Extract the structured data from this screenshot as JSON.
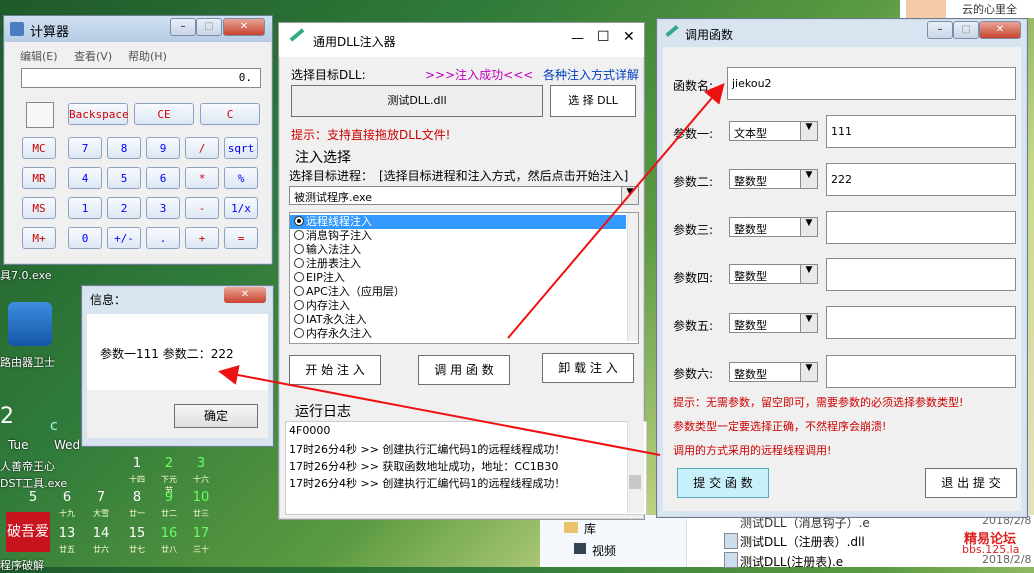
{
  "desktop": {
    "labels": {
      "tool70": "具7.0.exe",
      "router": "路由器卫士",
      "king": "人善帝王心",
      "dst": "DST工具.exe",
      "hack": "程序破解",
      "topright": "云的心里全",
      "folder": "库",
      "video": "视频",
      "file1": "测试DLL（注册表）.dll",
      "file2": "测试DLL(注册表).e",
      "file0": "测试DLL（消息钩子）.e",
      "date1": "2018/2/8",
      "date2": "2018/2/8",
      "watermark1": "精易论坛",
      "watermark2": "bbs.125.la",
      "stamp": "破吾爱"
    },
    "calendar": {
      "time_digit": "2",
      "day_c": "c",
      "weekdays": [
        "Tue",
        "Wed"
      ],
      "rows": [
        {
          "nums": [
            "1",
            "2",
            "3"
          ],
          "subs": [
            "十四",
            "下元节",
            "十六"
          ]
        },
        {
          "nums": [
            "5",
            "6",
            "7",
            "8",
            "9",
            "10"
          ],
          "subs": [
            "",
            "十九",
            "大雪",
            "廿一",
            "廿二",
            "廿三"
          ]
        },
        {
          "nums": [
            "12",
            "13",
            "14",
            "15",
            "16",
            "17"
          ],
          "subs": [
            "",
            "廿五",
            "廿六",
            "廿七",
            "廿八",
            "三十"
          ]
        }
      ]
    }
  },
  "calc": {
    "title": "计算器",
    "menu": [
      "编辑(E)",
      "查看(V)",
      "帮助(H)"
    ],
    "display": "0.",
    "top_buttons": [
      "Backspace",
      "CE",
      "C"
    ],
    "rows": [
      [
        "MC",
        "7",
        "8",
        "9",
        "/",
        "sqrt"
      ],
      [
        "MR",
        "4",
        "5",
        "6",
        "*",
        "%"
      ],
      [
        "MS",
        "1",
        "2",
        "3",
        "-",
        "1/x"
      ],
      [
        "M+",
        "0",
        "+/-",
        ".",
        "+",
        "="
      ]
    ]
  },
  "msgbox": {
    "title": "信息：",
    "close": "✕",
    "message": "参数一111 参数二：222",
    "ok": "确定"
  },
  "injector": {
    "title": "通用DLL注入器",
    "select_dll_label": "选择目标DLL:",
    "success": ">>>注入成功<<<",
    "methods_link": "各种注入方式详解",
    "dll_name": "测试DLL.dll",
    "select_dll_btn": "选 择 DLL",
    "hint": "提示：支持直接拖放DLL文件!",
    "group_title": "注入选择",
    "process_label": "选择目标进程：",
    "process_hint": "[选择目标进程和注入方式，然后点击开始注入]",
    "process_value": "被测试程序.exe",
    "methods": [
      "远程线程注入",
      "消息钩子注入",
      "输入法注入",
      "注册表注入",
      "EIP注入",
      "APC注入（应用层）",
      "内存注入",
      "IAT永久注入",
      "内存永久注入"
    ],
    "selected_method": "远程线程注入",
    "start_btn": "开 始 注 入",
    "call_btn": "调 用 函 数",
    "unload_btn": "卸 载 注 入",
    "log_title": "运行日志",
    "log": [
      "4F0000",
      "17时26分4秒 >> 创建执行汇编代码1的远程线程成功！",
      "17时26分4秒 >> 获取函数地址成功，地址：CC1B30",
      "17时26分4秒 >> 创建执行汇编代码1的远程线程成功！"
    ]
  },
  "callfn": {
    "title": "调用函数",
    "fn_label": "函数名:",
    "fn_value": "jiekou2",
    "params": [
      {
        "label": "参数一:",
        "type": "文本型",
        "value": "111"
      },
      {
        "label": "参数二:",
        "type": "整数型",
        "value": "222"
      },
      {
        "label": "参数三:",
        "type": "整数型",
        "value": ""
      },
      {
        "label": "参数四:",
        "type": "整数型",
        "value": ""
      },
      {
        "label": "参数五:",
        "type": "整数型",
        "value": ""
      },
      {
        "label": "参数六:",
        "type": "整数型",
        "value": ""
      }
    ],
    "tips": [
      "提示：无需参数，留空即可，需要参数的必须选择参数类型!",
      "参数类型一定要选择正确，不然程序会崩溃!",
      "调用的方式采用的远程线程调用!"
    ],
    "submit": "提 交 函 数",
    "exit": "退 出 提 交"
  },
  "colors": {
    "accent_red": "#cc0000",
    "link_blue": "#0040c0",
    "success_purple": "#c000c0"
  }
}
